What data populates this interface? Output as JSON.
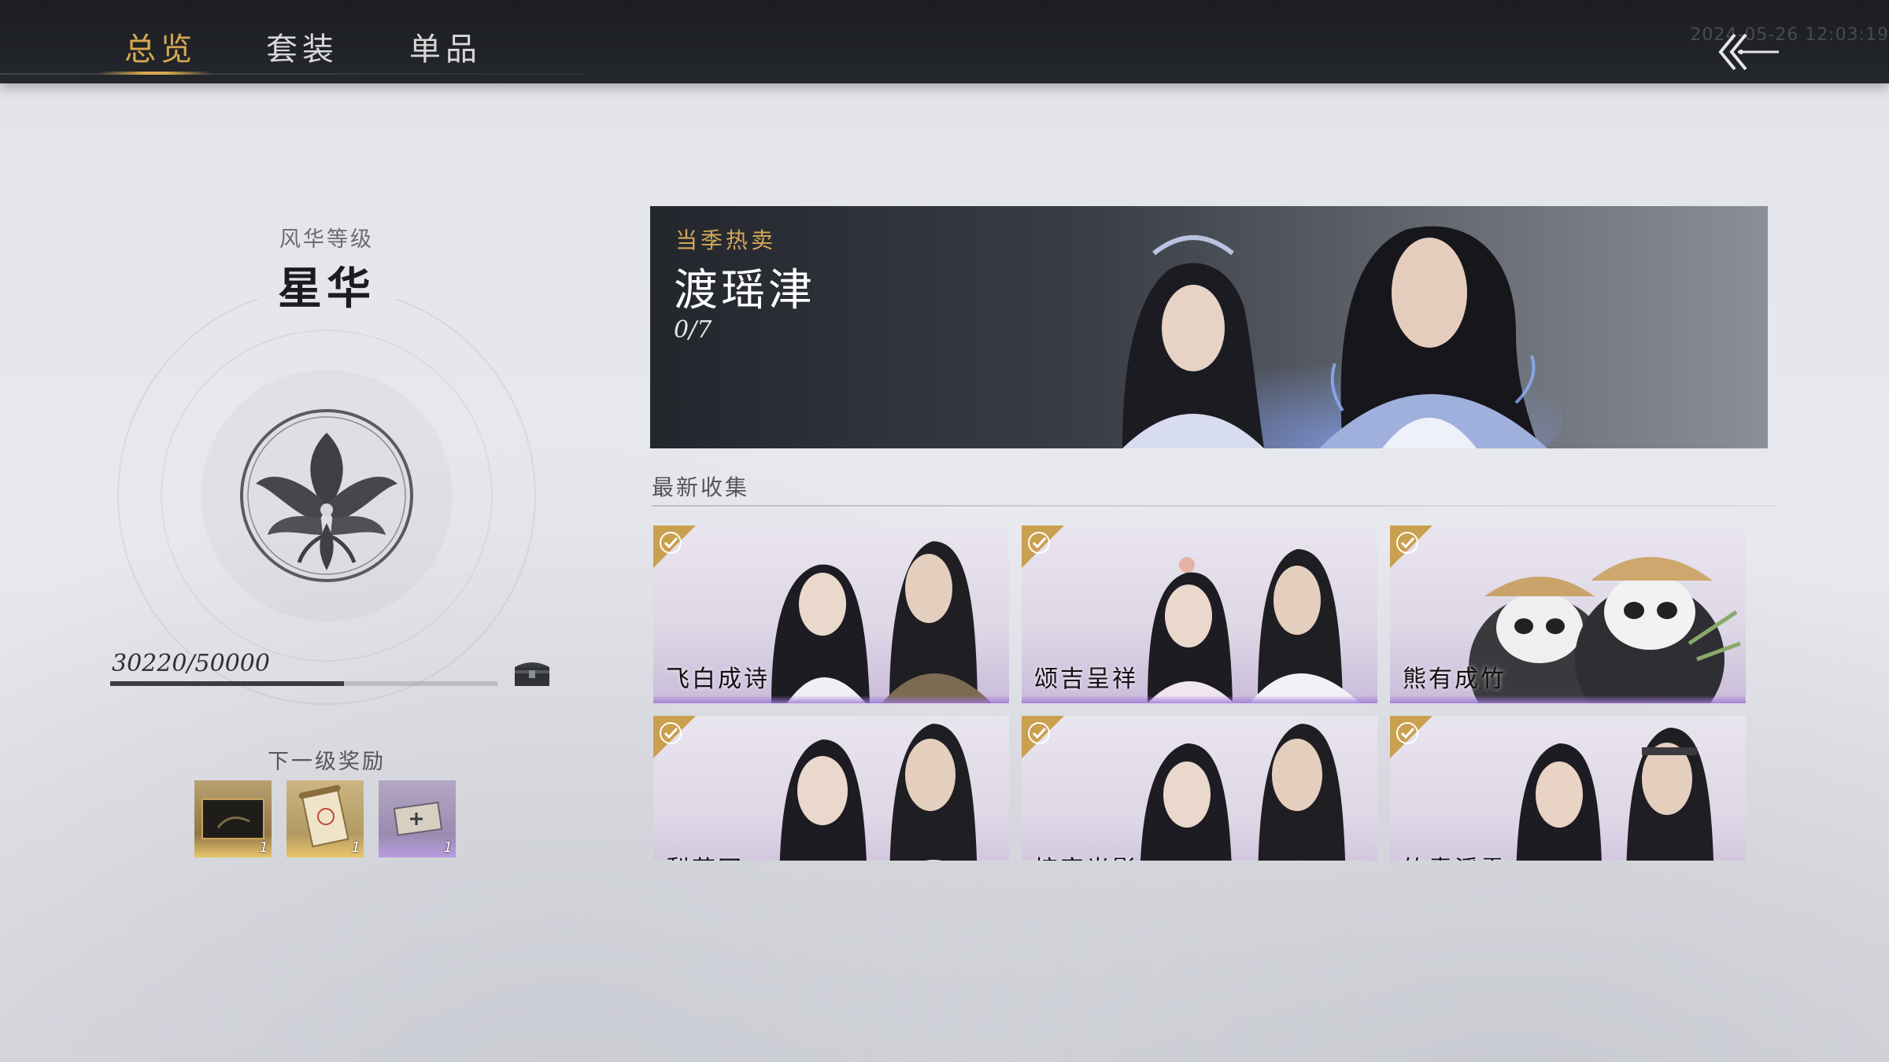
{
  "tabs": [
    {
      "label": "总览",
      "active": true
    },
    {
      "label": "套装",
      "active": false
    },
    {
      "label": "单品",
      "active": false
    }
  ],
  "timestamp": "2024-05-26 12:03:19",
  "rank": {
    "label": "风华等级",
    "title": "星华",
    "progress_text": "30220/50000",
    "progress_value": 30220,
    "progress_max": 50000
  },
  "next_reward": {
    "label": "下一级奖励",
    "items": [
      {
        "count": "1"
      },
      {
        "count": "1"
      },
      {
        "count": "1"
      }
    ]
  },
  "banner": {
    "subtitle": "当季热卖",
    "title": "渡瑶津",
    "progress": "0/7"
  },
  "collection": {
    "label": "最新收集",
    "items": [
      {
        "name": "飞白成诗"
      },
      {
        "name": "颂吉呈祥"
      },
      {
        "name": "熊有成竹"
      },
      {
        "name": "梨花冗"
      },
      {
        "name": "惊穹光影"
      },
      {
        "name": "竹青溪霜"
      }
    ]
  },
  "colors": {
    "accent_gold": "#d6a84e",
    "topbar_bg": "#1b1d21",
    "card_glow": "#a078dc"
  },
  "icons": {
    "back": "double-chevron-left-icon",
    "chest": "treasure-chest-icon",
    "emblem": "lotus-emblem-icon",
    "badge": "checkmark-badge-icon"
  }
}
